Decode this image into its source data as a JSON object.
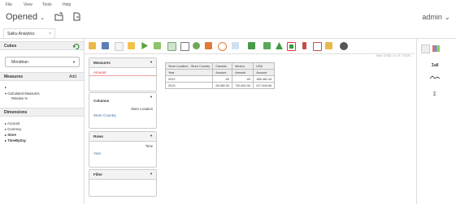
{
  "menu": [
    "File",
    "View",
    "Tools",
    "Help"
  ],
  "app": {
    "title": "Opened",
    "title_caret": "⌄",
    "user": "admin",
    "user_caret": "⌄"
  },
  "tab": {
    "label": "Saiku Analytics",
    "close": "×"
  },
  "sidebar": {
    "cubes_label": "Cubes",
    "cube_selected": "Mondrian",
    "measures_label": "Measures",
    "measures_add": "Add",
    "calc_toggle": "▸",
    "calc_item": "Calculated Measures",
    "calc_sub": "Relative %",
    "dimensions_label": "Dimensions",
    "dimensions": [
      "Account",
      "Currency",
      "Store",
      "TimeByDay"
    ],
    "dimension_toggle": "▸"
  },
  "dropzones": {
    "measures": {
      "title": "Measures",
      "items": [
        "Amount"
      ]
    },
    "columns": {
      "title": "Columns",
      "items": [
        "Store Location",
        "Store Country"
      ]
    },
    "rows": {
      "title": "Rows",
      "items": [
        "Time",
        "Year"
      ]
    },
    "filter": {
      "title": "Filter",
      "items": []
    }
  },
  "query_info": "Info: 10:52  /  4 x 4  /  0.07s",
  "table": {
    "header1": [
      "Store Location - Store Country",
      "Canada",
      "Mexico",
      "USA"
    ],
    "header2": [
      "Year",
      "Amount",
      "Amount",
      "Amount"
    ],
    "rows": [
      [
        "2012",
        "-00",
        "-00",
        "186,462.44"
      ],
      [
        "2013",
        "28,082.00",
        "790,821.94",
        "217,643.66"
      ]
    ]
  },
  "icons": [
    "folder-open-icon",
    "save-icon",
    "new-query-icon",
    "edit-icon",
    "run-icon",
    "automatic-execution-icon",
    "toggle-fields-icon",
    "toggle-sidebar-icon",
    "non-empty-icon",
    "swap-axis-icon",
    "zoom-icon",
    "drill-through-icon",
    "export-icon",
    "chart-icon",
    "sort-icon",
    "show-mdx-icon",
    "explain-icon",
    "query-icon",
    "info-icon"
  ],
  "colors": {
    "accent": "#3a6ea5",
    "selected_border": "#e33333"
  }
}
